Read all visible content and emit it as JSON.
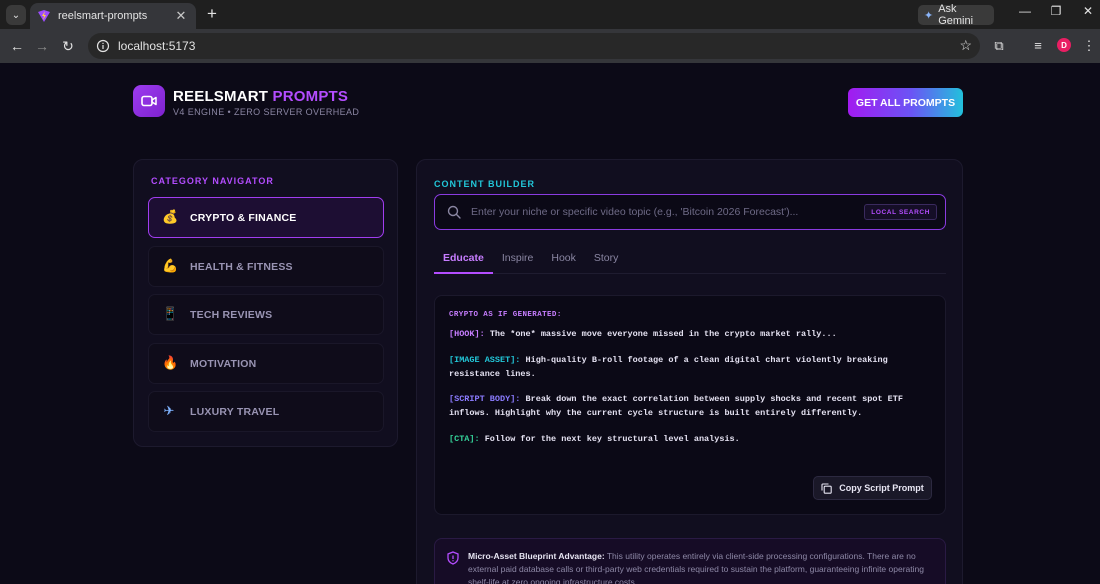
{
  "browser": {
    "tab_title": "reelsmart-prompts",
    "new_tab": "+",
    "gemini_label": "Ask Gemini",
    "url": "localhost:5173",
    "profile_initial": "D"
  },
  "header": {
    "brand_main": "REELSMART",
    "brand_accent": "PROMPTS",
    "subtitle": "V4 ENGINE • ZERO SERVER OVERHEAD",
    "cta_label": "GET ALL PROMPTS"
  },
  "sidebar": {
    "heading": "CATEGORY NAVIGATOR",
    "items": [
      {
        "emoji": "💰",
        "label": "CRYPTO & FINANCE",
        "active": true
      },
      {
        "emoji": "💪",
        "label": "HEALTH & FITNESS",
        "active": false
      },
      {
        "emoji": "📱",
        "label": "TECH REVIEWS",
        "active": false
      },
      {
        "emoji": "🔥",
        "label": "MOTIVATION",
        "active": false
      },
      {
        "emoji": "✈",
        "label": "LUXURY TRAVEL",
        "active": false
      }
    ]
  },
  "main": {
    "heading": "CONTENT BUILDER",
    "search_placeholder": "Enter your niche or specific video topic (e.g., 'Bitcoin 2026 Forecast')...",
    "search_badge": "LOCAL SEARCH",
    "tabs": [
      "Educate",
      "Inspire",
      "Hook",
      "Story"
    ],
    "active_tab": "Educate",
    "script": {
      "heading": "CRYPTO AS IF GENERATED:",
      "hook_tag": "[HOOK]:",
      "hook_text": " The *one* massive move everyone missed in the crypto market rally...",
      "image_tag": "[IMAGE ASSET]:",
      "image_text": " High-quality B-roll footage of a clean digital chart violently breaking resistance lines.",
      "body_tag": "[SCRIPT BODY]:",
      "body_text": " Break down the exact correlation between supply shocks and recent spot ETF inflows. Highlight why the current cycle structure is built entirely differently.",
      "cta_tag": "[CTA]:",
      "cta_text": " Follow for the next key structural level analysis."
    },
    "copy_label": "Copy Script Prompt",
    "blueprint_title": "Micro-Asset Blueprint Advantage:",
    "blueprint_text": " This utility operates entirely via client-side processing configurations. There are no external paid database calls or third-party web credentials required to sustain the platform, guaranteeing infinite operating shelf-life at zero ongoing infrastructure costs."
  },
  "colors": {
    "accent_purple": "#b44dff",
    "accent_cyan": "#22c7d9",
    "background": "#0c0a17"
  }
}
